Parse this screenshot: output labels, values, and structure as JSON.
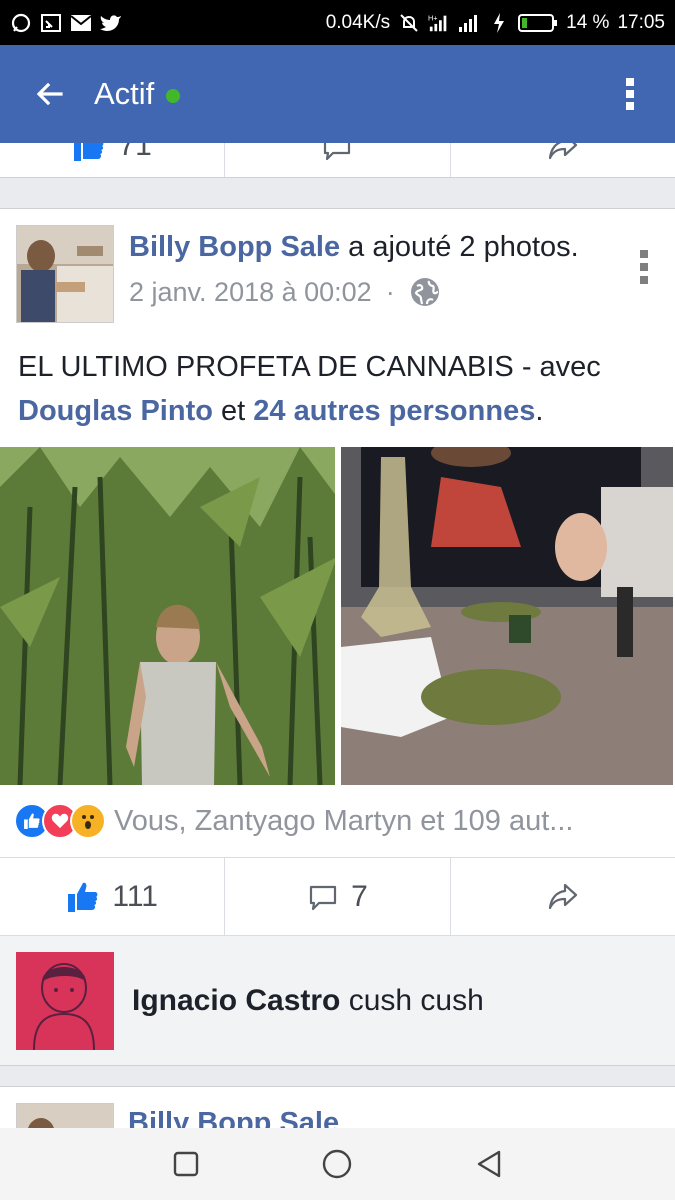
{
  "status_bar": {
    "speed": "0.04K/s",
    "battery": "14 %",
    "time": "17:05"
  },
  "app_bar": {
    "title": "Actif",
    "status_color": "#42b72a"
  },
  "previous_post": {
    "like_count": "71"
  },
  "post": {
    "author": "Billy Bopp Sale",
    "action": " a ajouté 2 photos.",
    "date": "2 janv. 2018 à 00:02",
    "separator": "·",
    "text_main": "EL ULTIMO PROFETA DE CANNABIS - avec ",
    "tag1": "Douglas Pinto",
    "text_mid": " et ",
    "tag2": "24 autres personnes",
    "text_end": ".",
    "reactions_summary": "Vous, Zantyago Martyn et 109 aut...",
    "like_count": "111",
    "comment_count": "7"
  },
  "comment": {
    "author": "Ignacio Castro",
    "text": " cush cush"
  },
  "next_post": {
    "author": "Billy Bopp Sale"
  },
  "colors": {
    "brand": "#4267b2",
    "link": "#4b67a1",
    "like_blue": "#1877f2"
  }
}
